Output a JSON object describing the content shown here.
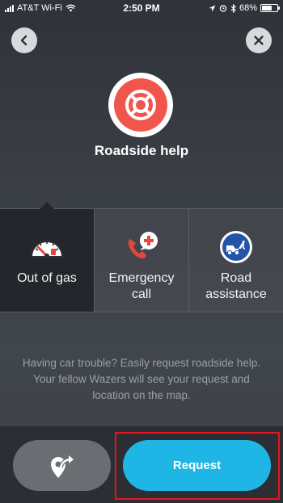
{
  "status_bar": {
    "carrier": "AT&T Wi-Fi",
    "time": "2:50 PM",
    "battery": "68%",
    "battery_level": 0.68
  },
  "nav": {
    "back_icon": "chevron-left-icon",
    "close_icon": "close-icon"
  },
  "hero": {
    "icon": "lifebuoy-icon",
    "title": "Roadside help",
    "accent_color": "#f1564d"
  },
  "options": [
    {
      "label": "Out of gas",
      "icon": "fuel-gauge-icon",
      "selected": true
    },
    {
      "label": "Emergency call",
      "icon": "emergency-phone-icon",
      "selected": false
    },
    {
      "label": "Road assistance",
      "icon": "tow-truck-icon",
      "selected": false
    }
  ],
  "description": "Having car trouble? Easily request roadside help. Your fellow Wazers will see your request and location on the map.",
  "actions": {
    "share_icon": "share-location-icon",
    "request_label": "Request",
    "request_color": "#1fb6e6",
    "highlight_color": "#e5141f"
  }
}
